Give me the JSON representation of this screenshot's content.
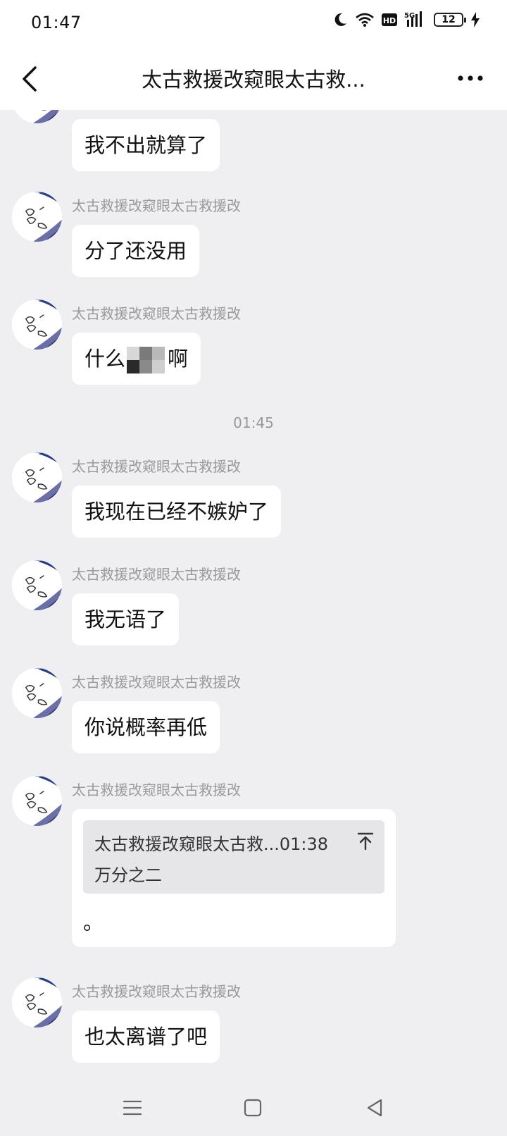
{
  "status": {
    "time": "01:47",
    "battery": "12",
    "network": "5G",
    "hd": "HD"
  },
  "header": {
    "title": "太古救援改窥眼太古救..."
  },
  "messages": [
    {
      "sender": "",
      "text": "我不出就算了"
    },
    {
      "sender": "太古救援改窥眼太古救援改",
      "text": "分了还没用"
    },
    {
      "sender": "太古救援改窥眼太古救援改",
      "text_before": "什么",
      "text_after": "啊"
    },
    {
      "sender": "太古救援改窥眼太古救援改",
      "text": "我现在已经不嫉妒了"
    },
    {
      "sender": "太古救援改窥眼太古救援改",
      "text": "我无语了"
    },
    {
      "sender": "太古救援改窥眼太古救援改",
      "text": "你说概率再低"
    },
    {
      "sender": "太古救援改窥眼太古救援改",
      "quote_head": "太古救援改窥眼太古救...01:38",
      "quote_body": "万分之二",
      "text": "。"
    },
    {
      "sender": "太古救援改窥眼太古救援改",
      "text": "也太离谱了吧"
    }
  ],
  "time_separator": "01:45",
  "icons": [
    "moon-icon",
    "wifi-icon",
    "hd-icon",
    "signal-icon",
    "battery-icon",
    "charging-icon",
    "back-icon",
    "more-icon",
    "jump-to-quote-icon",
    "menu-icon",
    "home-icon",
    "back-triangle-icon"
  ],
  "colors": {
    "background": "#efeff2",
    "bubble": "#ffffff",
    "sender_text": "#9a9a9a",
    "quote_bg": "#e6e6e8"
  }
}
